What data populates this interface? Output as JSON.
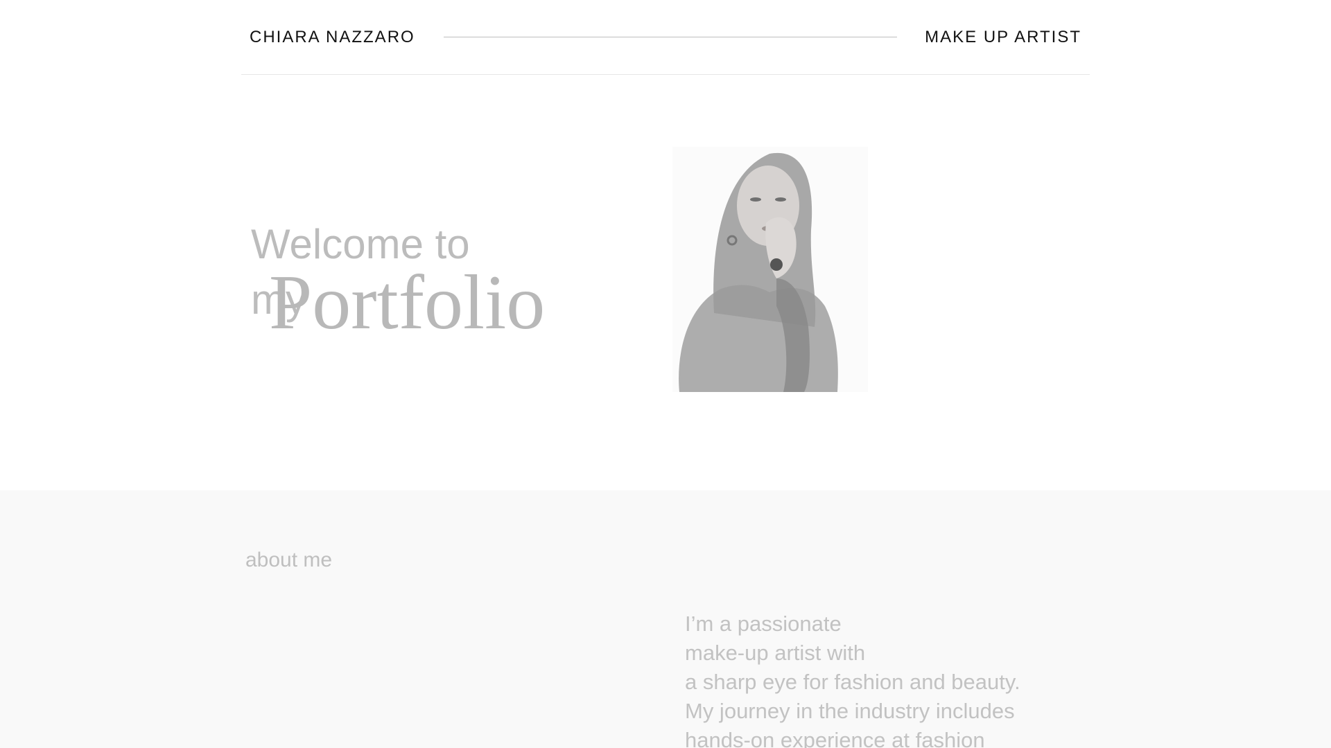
{
  "header": {
    "name": "CHIARA NAZZARO",
    "role": "MAKE UP ARTIST"
  },
  "hero": {
    "welcome_line1": "Welcome to",
    "welcome_line2": "my",
    "portfolio": "Portfolio"
  },
  "about": {
    "label": "about me",
    "bio_lines": [
      "I’m a passionate",
      "make-up artist with",
      "a sharp eye for fashion and beauty.",
      "My journey in the industry includes",
      "hands-on experience at fashion"
    ]
  },
  "colors": {
    "text_dark": "#111111",
    "text_faded": "#bcbcbc",
    "about_bg": "#f9f9f9"
  }
}
